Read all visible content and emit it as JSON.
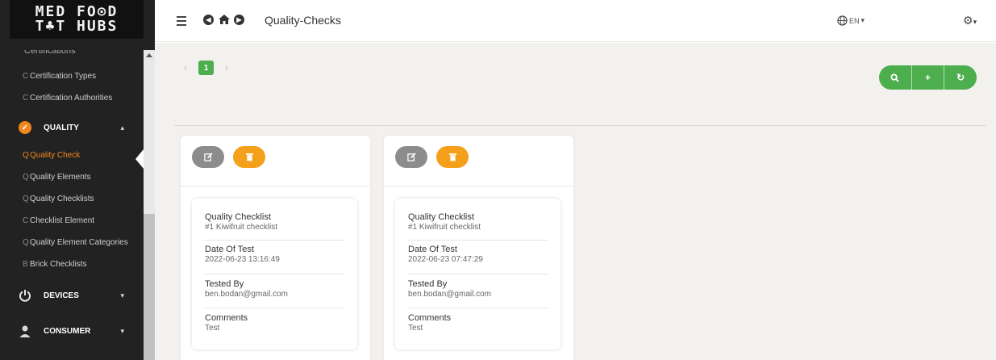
{
  "brand": {
    "line1": "MED FO⊙D",
    "line2_a": "T",
    "line2_b": "♣",
    "line2_c": "T HUBS"
  },
  "sidebar": {
    "cut_item": "Certifications",
    "items_top": [
      {
        "letter": "C",
        "label": "Certification Types"
      },
      {
        "letter": "C",
        "label": "Certification Authorities"
      }
    ],
    "sections": {
      "quality": {
        "label": "QUALITY",
        "caret": "▴"
      },
      "devices": {
        "label": "DEVICES",
        "caret": "▾"
      },
      "consumer": {
        "label": "CONSUMER",
        "caret": "▾"
      }
    },
    "quality_items": [
      {
        "letter": "Q",
        "label": "Quality Check"
      },
      {
        "letter": "Q",
        "label": "Quality Elements"
      },
      {
        "letter": "Q",
        "label": "Quality Checklists"
      },
      {
        "letter": "C",
        "label": "Checklist Element"
      },
      {
        "letter": "Q",
        "label": "Quality Element Categories"
      },
      {
        "letter": "B",
        "label": "Brick Checklists"
      }
    ],
    "active_index": 0
  },
  "topbar": {
    "title": "Quality-Checks",
    "language": "EN",
    "caret": "▾"
  },
  "pagination": {
    "prev": "‹",
    "current": "1",
    "next": "›"
  },
  "actions": {
    "search": "⚲",
    "add": "+",
    "refresh": "↻"
  },
  "cards": [
    {
      "fields": [
        {
          "label": "Quality Checklist",
          "value": "#1 Kiwifruit checklist"
        },
        {
          "label": "Date Of Test",
          "value": "2022-06-23 13:16:49"
        },
        {
          "label": "Tested By",
          "value": "ben.bodan@gmail.com"
        },
        {
          "label": "Comments",
          "value": "Test"
        }
      ]
    },
    {
      "fields": [
        {
          "label": "Quality Checklist",
          "value": "#1 Kiwifruit checklist"
        },
        {
          "label": "Date Of Test",
          "value": "2022-06-23 07:47:29"
        },
        {
          "label": "Tested By",
          "value": "ben.bodan@gmail.com"
        },
        {
          "label": "Comments",
          "value": "Test"
        }
      ]
    }
  ],
  "colors": {
    "accent_green": "#4cae4c",
    "accent_orange": "#f0871d",
    "delete_orange": "#f5a01a",
    "sidebar_bg": "#222222"
  }
}
